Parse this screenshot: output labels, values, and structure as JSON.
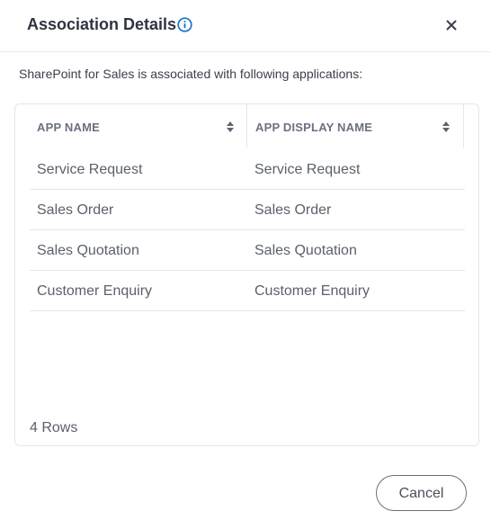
{
  "dialog": {
    "title": "Association Details",
    "description": "SharePoint for Sales is associated with following applications:",
    "cancel_label": "Cancel"
  },
  "table": {
    "columns": [
      "APP NAME",
      "APP DISPLAY NAME"
    ],
    "rows": [
      {
        "app_name": "Service Request",
        "display_name": "Service Request"
      },
      {
        "app_name": "Sales Order",
        "display_name": "Sales Order"
      },
      {
        "app_name": "Sales Quotation",
        "display_name": "Sales Quotation"
      },
      {
        "app_name": "Customer Enquiry",
        "display_name": "Customer Enquiry"
      }
    ],
    "row_count": "4 Rows"
  },
  "icons": {
    "info": "info-circle-icon",
    "close": "close-icon",
    "sort": "sort-icon"
  },
  "colors": {
    "accent": "#1a73c8",
    "title": "#2e3440",
    "border": "#e4e6ea"
  }
}
